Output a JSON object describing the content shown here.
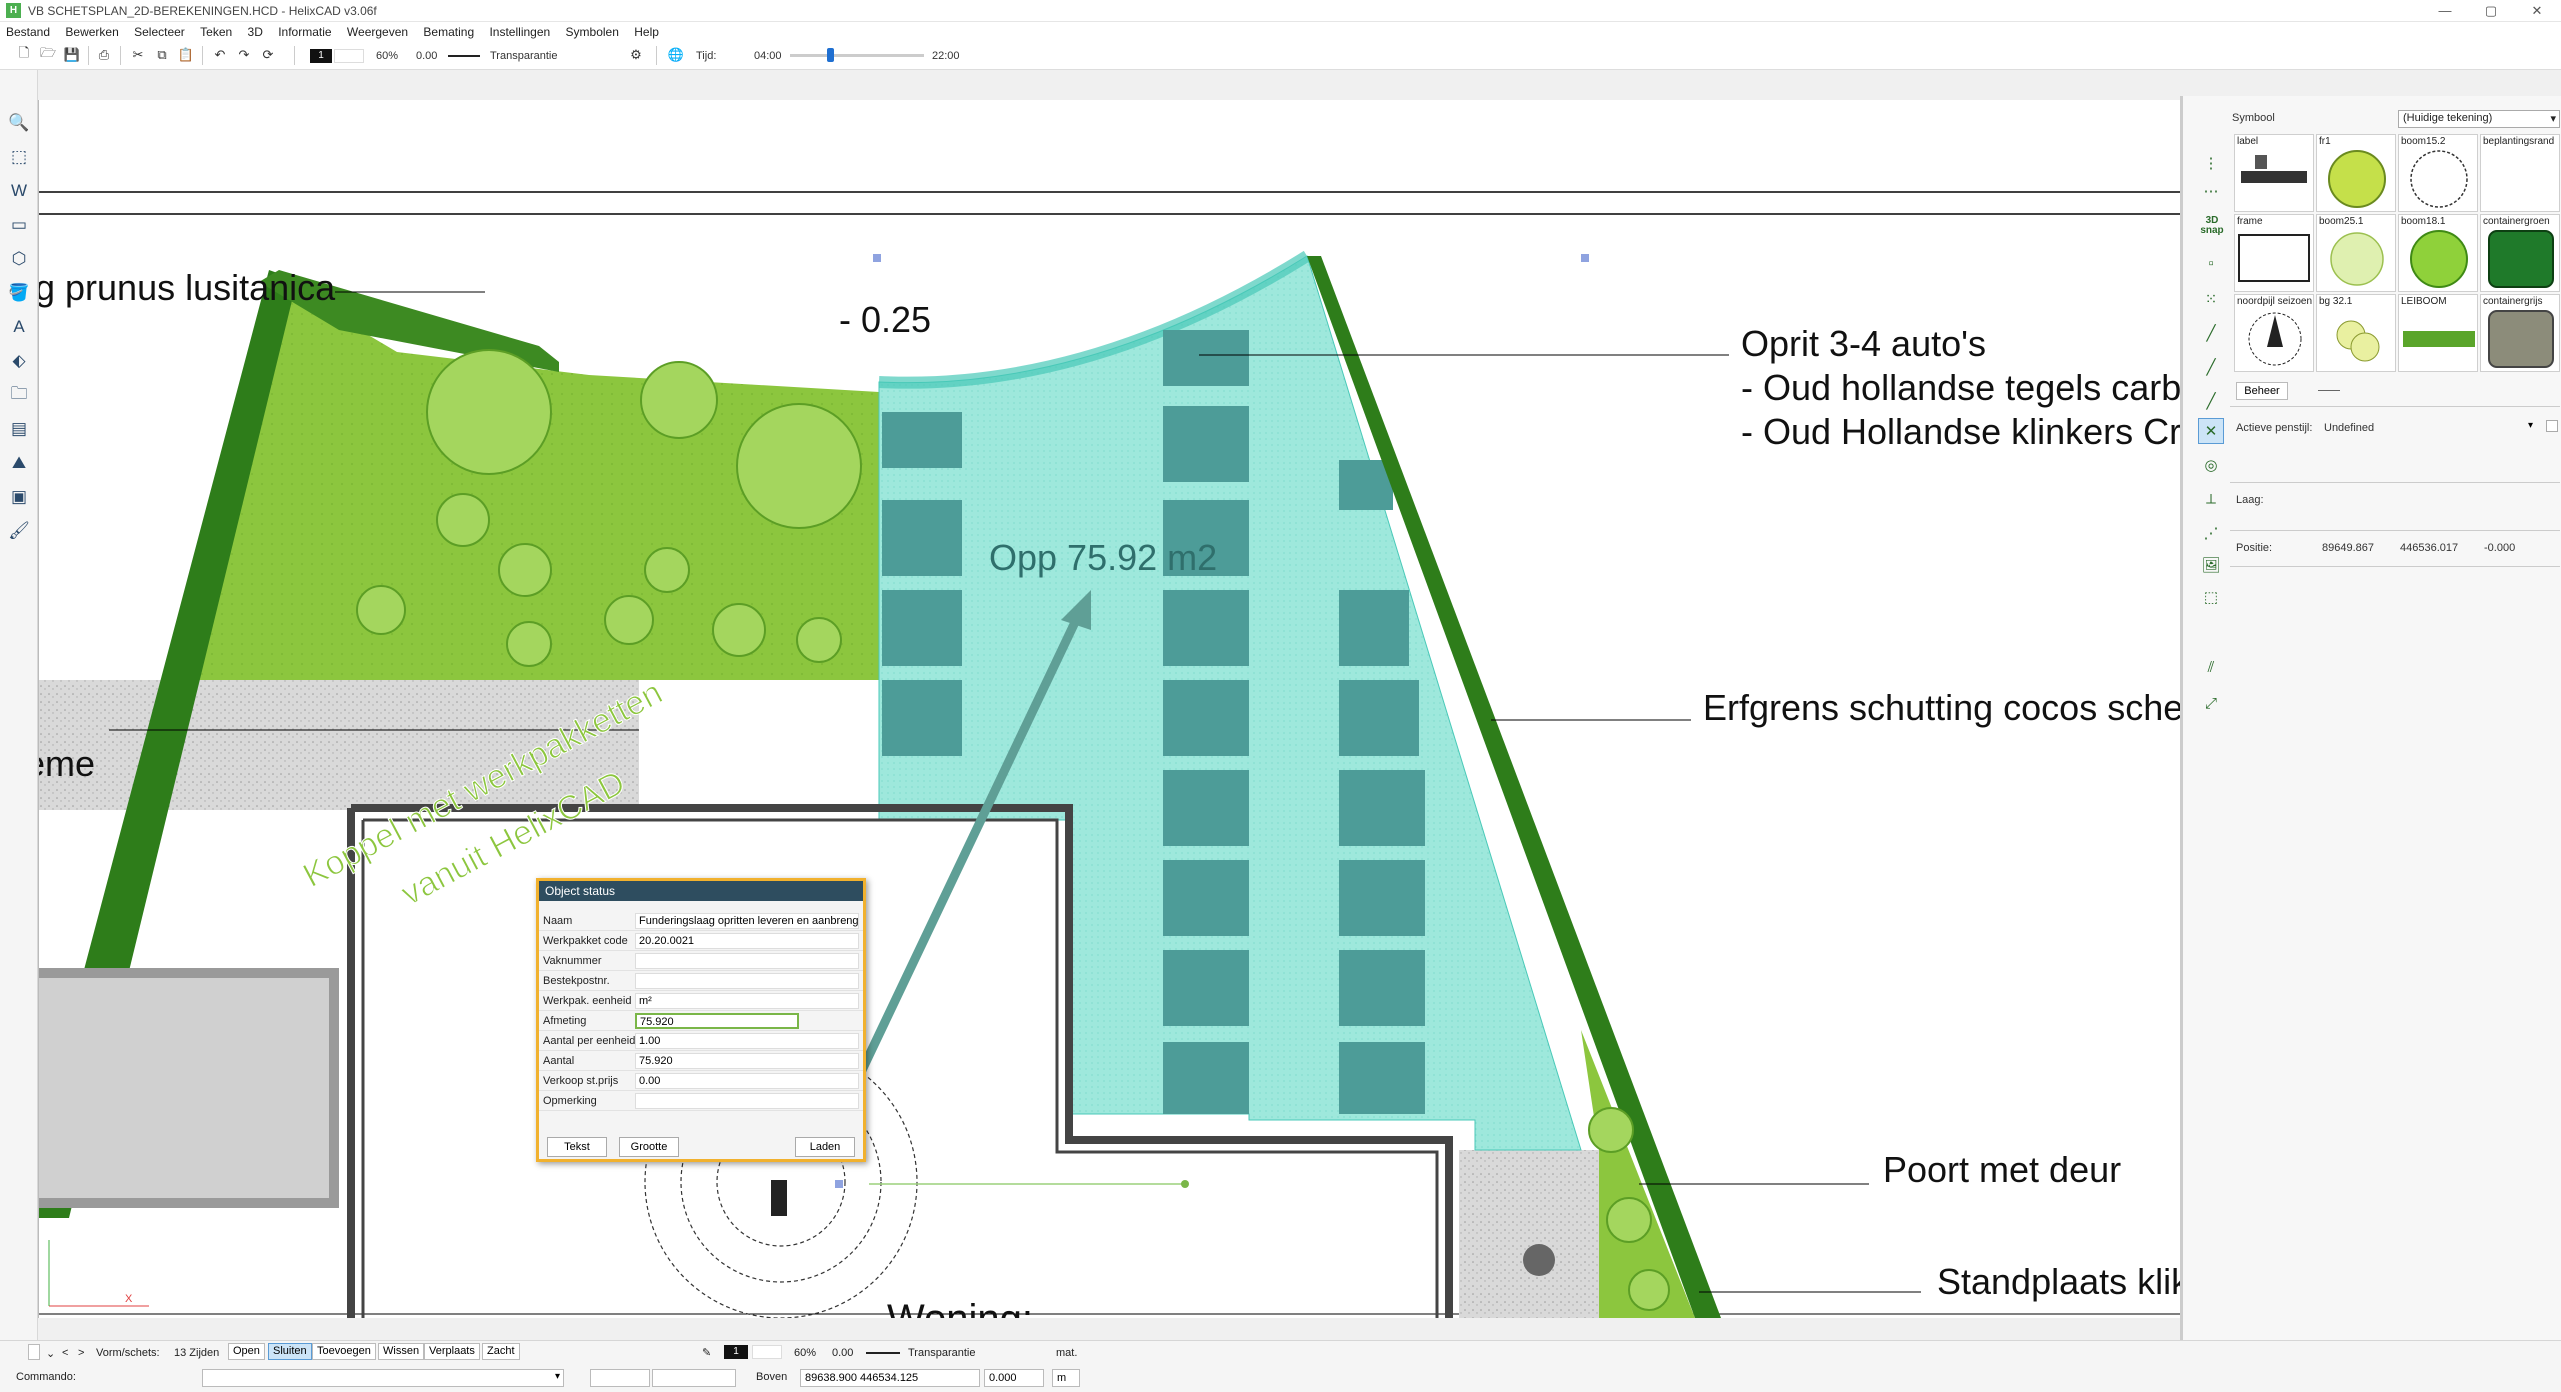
{
  "window": {
    "title": "VB SCHETSPLAN_2D-BEREKENINGEN.HCD  -  HelixCAD v3.06f",
    "app_icon_text": "H",
    "controls": {
      "minimize": "—",
      "maximize": "▢",
      "close": "✕"
    }
  },
  "menu": [
    "Bestand",
    "Bewerken",
    "Selecteer",
    "Teken",
    "3D",
    "Informatie",
    "Weergeven",
    "Bemating",
    "Instellingen",
    "Symbolen",
    "Help"
  ],
  "toolbar": {
    "layer_number": "1",
    "opacity": "60%",
    "line_width": "0.00",
    "transparency_label": "Transparantie",
    "time_label": "Tijd:",
    "time_start": "04:00",
    "time_end": "22:00",
    "time_slider_fraction": 0.3
  },
  "drawing": {
    "labels": {
      "plant": "g prunus lusitanica",
      "level": "- 0.25",
      "driveway_title": "Oprit 3-4 auto's",
      "driveway_line2": "- Oud hollandse tegels carb",
      "driveway_line3": "- Oud Hollandse klinkers Cre",
      "area": "Opp 75.92 m2",
      "fence": "Erfgrens schutting cocos sche",
      "left_partial": "eme",
      "gate": "Poort met deur",
      "stand": "Standplaats klik",
      "house": "Woning:",
      "promo_line1": "Koppel met werkpakketten",
      "promo_line2": "vanuit HelixCAD",
      "axis_x": "X"
    },
    "colors": {
      "lawn": "#8cc63e",
      "hedge": "#2e7d1a",
      "driveway": "#9ee8dc",
      "tile": "#4d9c98",
      "gravel": "#d4d4d4",
      "arrow": "#5f9f96",
      "promo_text": "#8cc63e"
    }
  },
  "dialog": {
    "title": "Object status",
    "rows": [
      {
        "label": "Naam",
        "value": "Funderingslaag opritten leveren en aanbrengen"
      },
      {
        "label": "Werkpakket code",
        "value": "20.20.0021"
      },
      {
        "label": "Vaknummer",
        "value": ""
      },
      {
        "label": "Bestekpostnr.",
        "value": ""
      },
      {
        "label": "Werkpak. eenheid",
        "value": "m²"
      },
      {
        "label": "Afmeting",
        "value": "75.920"
      },
      {
        "label": "Aantal per eenheid",
        "value": "1.00"
      },
      {
        "label": "Aantal",
        "value": "75.920"
      },
      {
        "label": "Verkoop st.prijs",
        "value": "0.00"
      },
      {
        "label": "Opmerking",
        "value": ""
      }
    ],
    "buttons": {
      "text": "Tekst",
      "size": "Grootte",
      "load": "Laden"
    }
  },
  "right_panel": {
    "symbol_label": "Symbool",
    "symbol_source": "(Huidige tekening)",
    "symbols": [
      {
        "label": "label",
        "icon": "label-symbol"
      },
      {
        "label": "fr1",
        "icon": "tree-symbol"
      },
      {
        "label": "boom15.2",
        "icon": "tree-outline-symbol"
      },
      {
        "label": "beplantingsrand",
        "icon": "border-symbol"
      },
      {
        "label": "frame",
        "icon": "frame-symbol"
      },
      {
        "label": "boom25.1",
        "icon": "tree-symbol"
      },
      {
        "label": "boom18.1",
        "icon": "tree-symbol"
      },
      {
        "label": "containergroen",
        "icon": "container-symbol"
      },
      {
        "label": "noordpijl seizoen",
        "icon": "north-arrow-symbol"
      },
      {
        "label": "bg 32.1",
        "icon": "shrub-symbol"
      },
      {
        "label": "LEIBOOM",
        "icon": "espalier-symbol"
      },
      {
        "label": "containergrijs",
        "icon": "container-symbol"
      }
    ],
    "manage_button": "Beheer",
    "active_pen_label": "Actieve penstijl:",
    "active_pen_value": "Undefined",
    "layer_label": "Laag:",
    "position_label": "Positie:",
    "position_x": "89649.867",
    "position_y": "446536.017",
    "position_z": "-0.000",
    "snap_label": "3D snap"
  },
  "statusbar": {
    "shape_label": "Vorm/schets:",
    "sides": "13 Zijden",
    "buttons": [
      "Open",
      "Sluiten",
      "Toevoegen",
      "Wissen",
      "Verplaats",
      "Zacht"
    ],
    "active_button": "Sluiten",
    "layer_number": "1",
    "opacity": "60%",
    "line_width": "0.00",
    "transparency_label": "Transparantie",
    "material": "mat.",
    "command_label": "Commando:",
    "view_label": "Boven",
    "coords": "89638.900 446534.125",
    "z_value": "0.000",
    "unit": "m"
  }
}
